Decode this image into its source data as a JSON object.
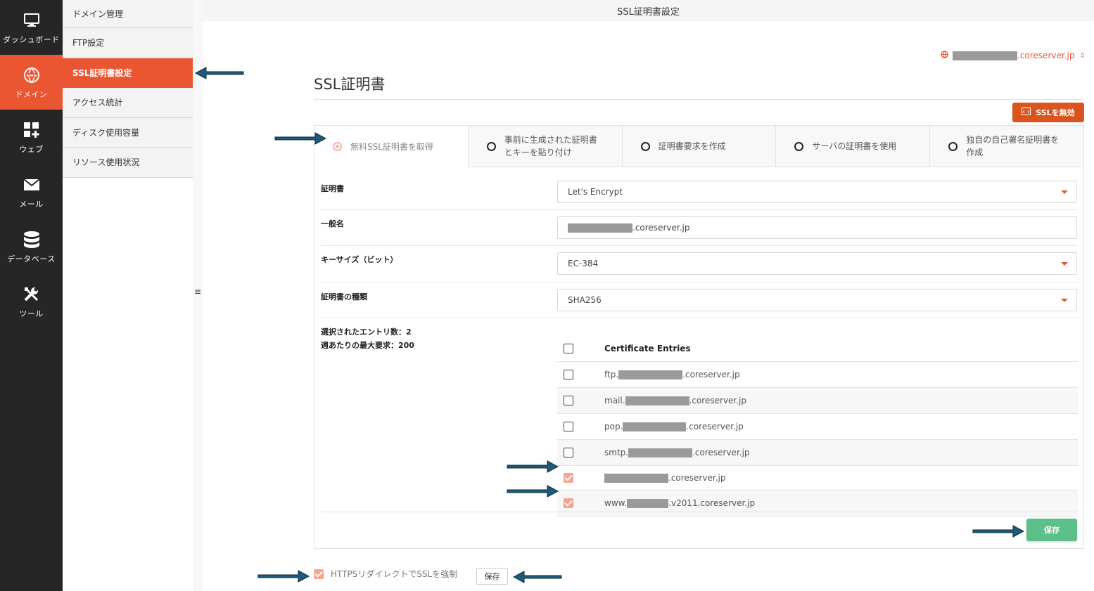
{
  "iconbar": {
    "items": [
      {
        "label": "ダッシュボード",
        "icon": "monitor-icon"
      },
      {
        "label": "ドメイン",
        "icon": "www-globe-icon"
      },
      {
        "label": "ウェブ",
        "icon": "grid-plus-icon"
      },
      {
        "label": "メール",
        "icon": "envelope-icon"
      },
      {
        "label": "データベース",
        "icon": "database-icon"
      },
      {
        "label": "ツール",
        "icon": "tools-icon"
      }
    ]
  },
  "subnav": {
    "items": [
      {
        "label": "ドメイン管理"
      },
      {
        "label": "FTP設定"
      },
      {
        "label": "SSL証明書設定"
      },
      {
        "label": "アクセス統計"
      },
      {
        "label": "ディスク使用容量"
      },
      {
        "label": "リソース使用状況"
      }
    ]
  },
  "topbar": {
    "title": "SSL証明書設定"
  },
  "domain_selector": {
    "suffix": ".coreserver.jp"
  },
  "page": {
    "title": "SSL証明書"
  },
  "ssl_disable_button": "SSLを無効",
  "tabs": [
    {
      "label": "無料SSL証明書を取得"
    },
    {
      "label": "事前に生成された証明書とキーを貼り付け"
    },
    {
      "label": "証明書要求を作成"
    },
    {
      "label": "サーバの証明書を使用"
    },
    {
      "label": "独自の自己署名証明書を作成"
    }
  ],
  "form": {
    "certificate": {
      "label": "証明書",
      "value": "Let's Encrypt"
    },
    "common_name": {
      "label": "一般名",
      "suffix": ".coreserver.jp"
    },
    "key_size": {
      "label": "キーサイズ（ビット）",
      "value": "EC-384"
    },
    "cert_type": {
      "label": "証明書の種類",
      "value": "SHA256"
    }
  },
  "entries_info": {
    "selected": "選択されたエントリ数：2",
    "weekly_max": "週あたりの最大要求：200"
  },
  "certificate_entries": {
    "header": "Certificate Entries",
    "rows": [
      {
        "prefix": "ftp.",
        "suffix": ".coreserver.jp"
      },
      {
        "prefix": "mail.",
        "suffix": ".coreserver.jp"
      },
      {
        "prefix": "pop.",
        "suffix": ".coreserver.jp"
      },
      {
        "prefix": "smtp.",
        "suffix": ".coreserver.jp"
      },
      {
        "prefix": "",
        "suffix": ".coreserver.jp"
      },
      {
        "prefix": "www.",
        "suffix": ".v2011.coreserver.jp"
      }
    ]
  },
  "save_button": "保存",
  "https_redirect": {
    "label": "HTTPSリダイレクトでSSLを強制",
    "save": "保存"
  },
  "colors": {
    "accent": "#ea5532",
    "sidebar": "#262626",
    "save": "#5cc08a",
    "arrow": "#1e5b7a"
  }
}
